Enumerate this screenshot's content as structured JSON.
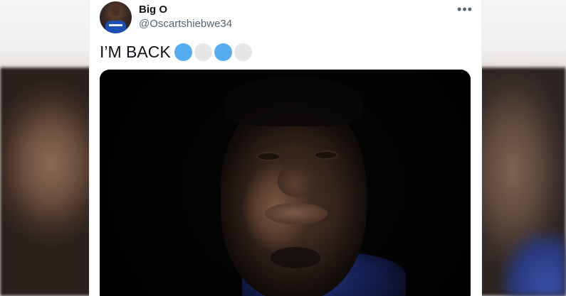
{
  "tweet": {
    "display_name": "Big O",
    "handle": "@Oscartshiebwe34",
    "text": "I’M BACK",
    "emoji": [
      "blue-circle",
      "white-circle",
      "blue-circle",
      "white-circle"
    ],
    "more_label": "•••"
  },
  "colors": {
    "blue_circle": "#55acee",
    "white_circle": "#e6e7e8",
    "name": "#0f1419",
    "handle": "#536471"
  }
}
